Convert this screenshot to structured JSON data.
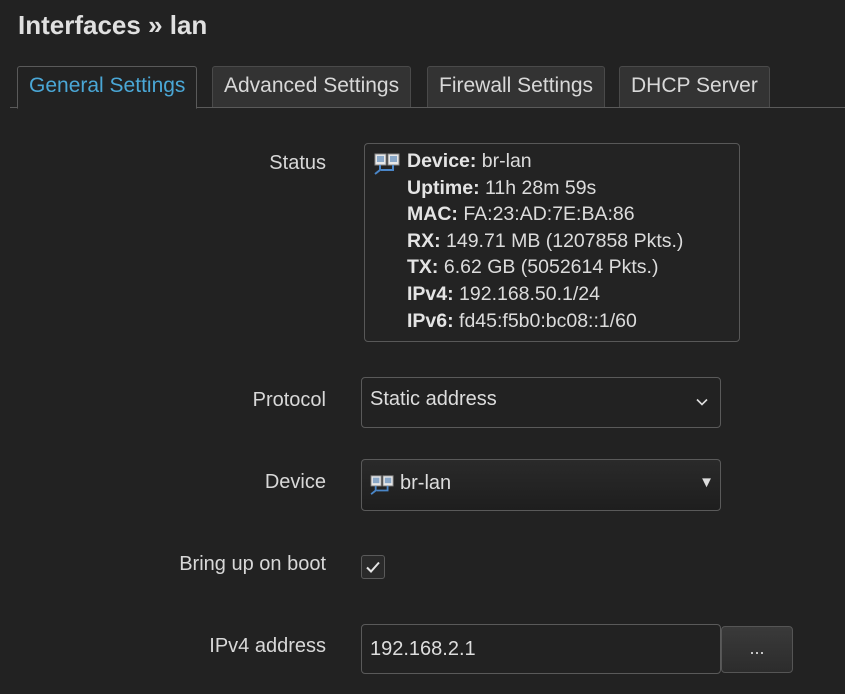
{
  "header": {
    "title": "Interfaces » lan"
  },
  "tabs": [
    {
      "label": "General Settings",
      "active": true
    },
    {
      "label": "Advanced Settings",
      "active": false
    },
    {
      "label": "Firewall Settings",
      "active": false
    },
    {
      "label": "DHCP Server",
      "active": false
    }
  ],
  "form": {
    "status": {
      "label": "Status",
      "icon": "network-bridge-icon",
      "device_key": "Device:",
      "device_val": "br-lan",
      "uptime_key": "Uptime:",
      "uptime_val": "11h 28m 59s",
      "mac_key": "MAC:",
      "mac_val": "FA:23:AD:7E:BA:86",
      "rx_key": "RX:",
      "rx_val": "149.71 MB (1207858 Pkts.)",
      "tx_key": "TX:",
      "tx_val": "6.62 GB (5052614 Pkts.)",
      "ipv4_key": "IPv4:",
      "ipv4_val": "192.168.50.1/24",
      "ipv6_key": "IPv6:",
      "ipv6_val": "fd45:f5b0:bc08::1/60"
    },
    "protocol": {
      "label": "Protocol",
      "value": "Static address"
    },
    "device": {
      "label": "Device",
      "value": "br-lan",
      "icon": "network-bridge-icon"
    },
    "boot": {
      "label": "Bring up on boot",
      "checked": true
    },
    "ipv4": {
      "label": "IPv4 address",
      "value": "192.168.2.1",
      "more_label": "..."
    }
  },
  "colors": {
    "background": "#222222",
    "accent": "#4aa7d6",
    "border": "#5a5a5a"
  }
}
